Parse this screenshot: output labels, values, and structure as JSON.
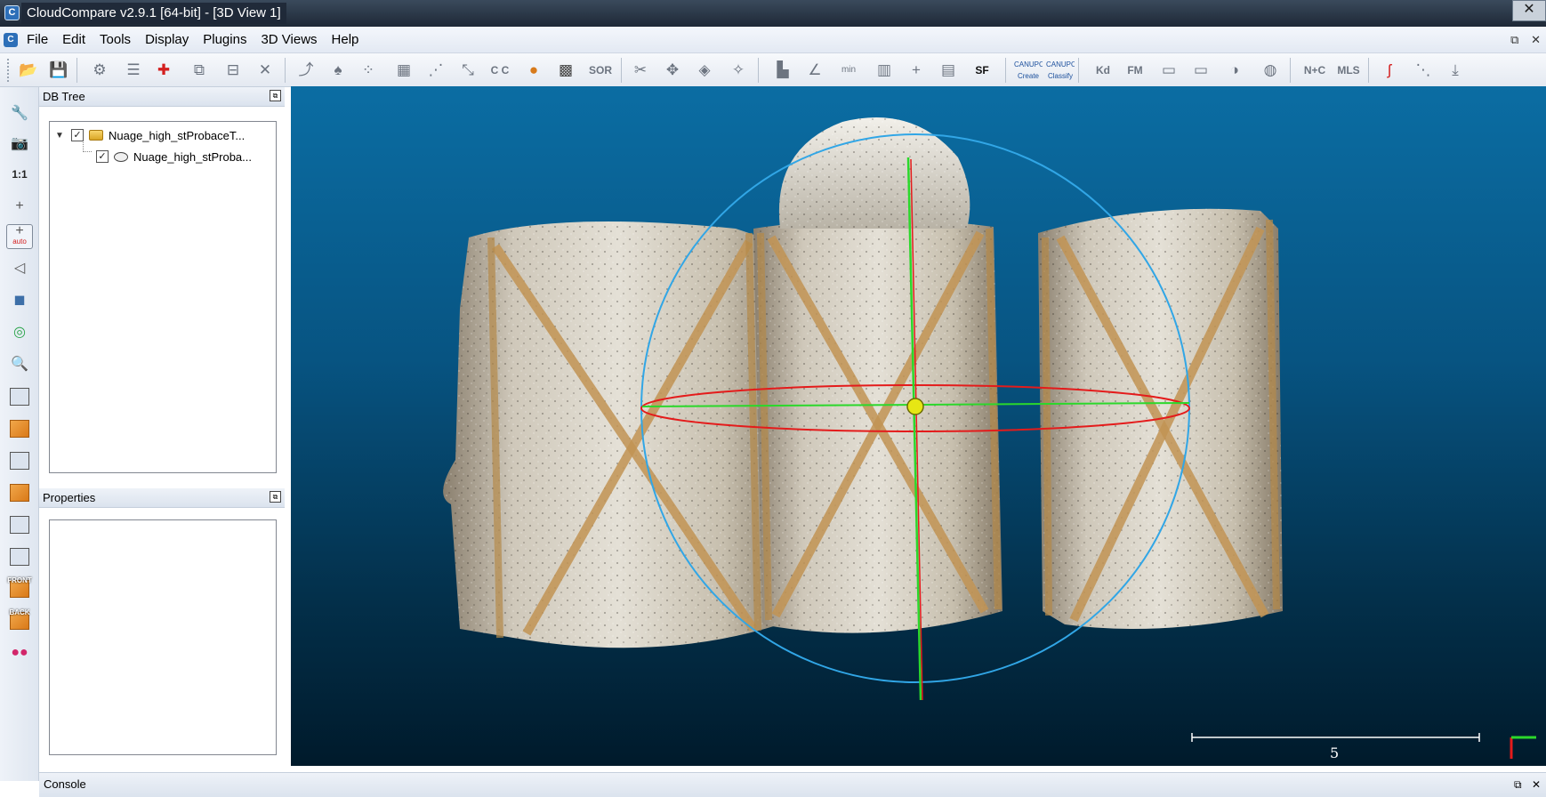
{
  "window": {
    "title": "CloudCompare v2.9.1 [64-bit] - [3D View 1]",
    "close_glyph": "✕"
  },
  "menu": {
    "items": [
      "File",
      "Edit",
      "Tools",
      "Display",
      "Plugins",
      "3D Views",
      "Help"
    ],
    "window_controls": [
      "⧉",
      "✕"
    ]
  },
  "toolbar": {
    "labels": [
      "SOR",
      "SF",
      "Kd",
      "FM",
      "N+C",
      "MLS"
    ],
    "canupo_create": "Create",
    "canupo_classify": "Classify",
    "canupo_label": "CANUPO"
  },
  "lefttools": {
    "scale_label": "1:1",
    "auto_label": "auto",
    "front_label": "FRONT",
    "back_label": "BACK"
  },
  "db_tree": {
    "title": "DB Tree",
    "items": [
      {
        "label": "Nuage_high_stProbaceT...",
        "checked": true,
        "type": "folder"
      },
      {
        "label": "Nuage_high_stProba...",
        "checked": true,
        "type": "cloud"
      }
    ]
  },
  "properties": {
    "title": "Properties"
  },
  "view": {
    "scale_value": "5"
  },
  "console": {
    "title": "Console",
    "controls": [
      "⧉",
      "✕"
    ]
  },
  "colors": {
    "gizmo_circle": "#31a6e6",
    "gizmo_ellipse": "#e41b1b",
    "gizmo_axis_green": "#2bd82b",
    "pivot": "#e6e614"
  }
}
